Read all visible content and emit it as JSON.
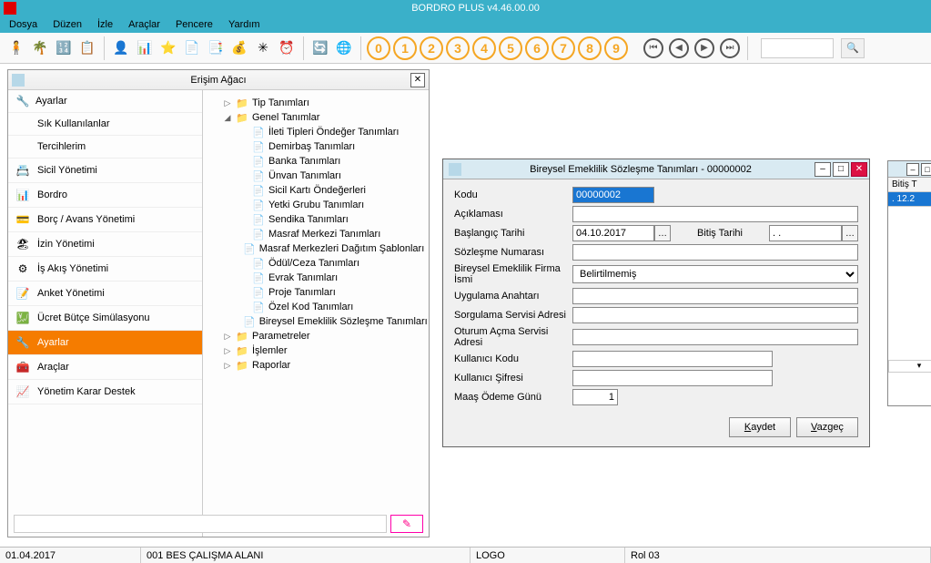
{
  "app": {
    "title": "BORDRO PLUS v4.46.00.00"
  },
  "menu": [
    "Dosya",
    "Düzen",
    "İzle",
    "Araçlar",
    "Pencere",
    "Yardım"
  ],
  "numbers": [
    "0",
    "1",
    "2",
    "3",
    "4",
    "5",
    "6",
    "7",
    "8",
    "9"
  ],
  "tree_panel": {
    "title": "Erişim Ağacı",
    "sidebar_top": {
      "label": "Ayarlar"
    },
    "sidebar_subs": [
      "Sık Kullanılanlar",
      "Tercihlerim"
    ],
    "sidebar_items": [
      "Sicil Yönetimi",
      "Bordro",
      "Borç / Avans Yönetimi",
      "İzin Yönetimi",
      "İş Akış Yönetimi",
      "Anket Yönetimi",
      "Ücret Bütçe Simülasyonu",
      "Ayarlar",
      "Araçlar",
      "Yönetim Karar Destek"
    ],
    "selected_index": 7,
    "tree": {
      "root": [
        {
          "label": "Tip Tanımları",
          "exp": "closed"
        },
        {
          "label": "Genel Tanımlar",
          "exp": "open",
          "children": [
            "İleti Tipleri Öndeğer Tanımları",
            "Demirbaş Tanımları",
            "Banka Tanımları",
            "Ünvan Tanımları",
            "Sicil Kartı Öndeğerleri",
            "Yetki Grubu Tanımları",
            "Sendika Tanımları",
            "Masraf Merkezi Tanımları",
            "Masraf Merkezleri Dağıtım Şablonları",
            "Ödül/Ceza Tanımları",
            "Evrak Tanımları",
            "Proje Tanımları",
            "Özel Kod Tanımları",
            "Bireysel Emeklilik Sözleşme Tanımları"
          ]
        },
        {
          "label": "Parametreler",
          "exp": "closed"
        },
        {
          "label": "İşlemler",
          "exp": "closed"
        },
        {
          "label": "Raporlar",
          "exp": "closed"
        }
      ]
    }
  },
  "bg_window": {
    "col_header": "Bitiş T",
    "date_cell": ". 12.2"
  },
  "dialog": {
    "title": "Bireysel Emeklilik Sözleşme Tanımları - 00000002",
    "fields": {
      "kodu": {
        "label": "Kodu",
        "value": "00000002"
      },
      "aciklamasi": {
        "label": "Açıklaması",
        "value": ""
      },
      "baslangic": {
        "label": "Başlangıç Tarihi",
        "value": "04.10.2017"
      },
      "bitis_lbl": "Bitiş Tarihi",
      "bitis_val": ". .",
      "sozlesme": {
        "label": "Sözleşme Numarası",
        "value": ""
      },
      "firma": {
        "label": "Bireysel Emeklilik Firma İsmi",
        "value": "Belirtilmemiş"
      },
      "anahtar": {
        "label": "Uygulama Anahtarı",
        "value": ""
      },
      "sorgulama": {
        "label": "Sorgulama Servisi Adresi",
        "value": ""
      },
      "oturum": {
        "label": "Oturum Açma Servisi Adresi",
        "value": ""
      },
      "kullanici_kodu": {
        "label": "Kullanıcı Kodu",
        "value": ""
      },
      "kullanici_sifresi": {
        "label": "Kullanıcı Şifresi",
        "value": ""
      },
      "maas_gunu": {
        "label": "Maaş Ödeme Günü",
        "value": "1"
      }
    },
    "buttons": {
      "save": "Kaydet",
      "cancel": "Vazgeç"
    }
  },
  "statusbar": {
    "date": "01.04.2017",
    "workspace": "001 BES ÇALIŞMA ALANI",
    "logo": "LOGO",
    "role": "Rol 03"
  }
}
